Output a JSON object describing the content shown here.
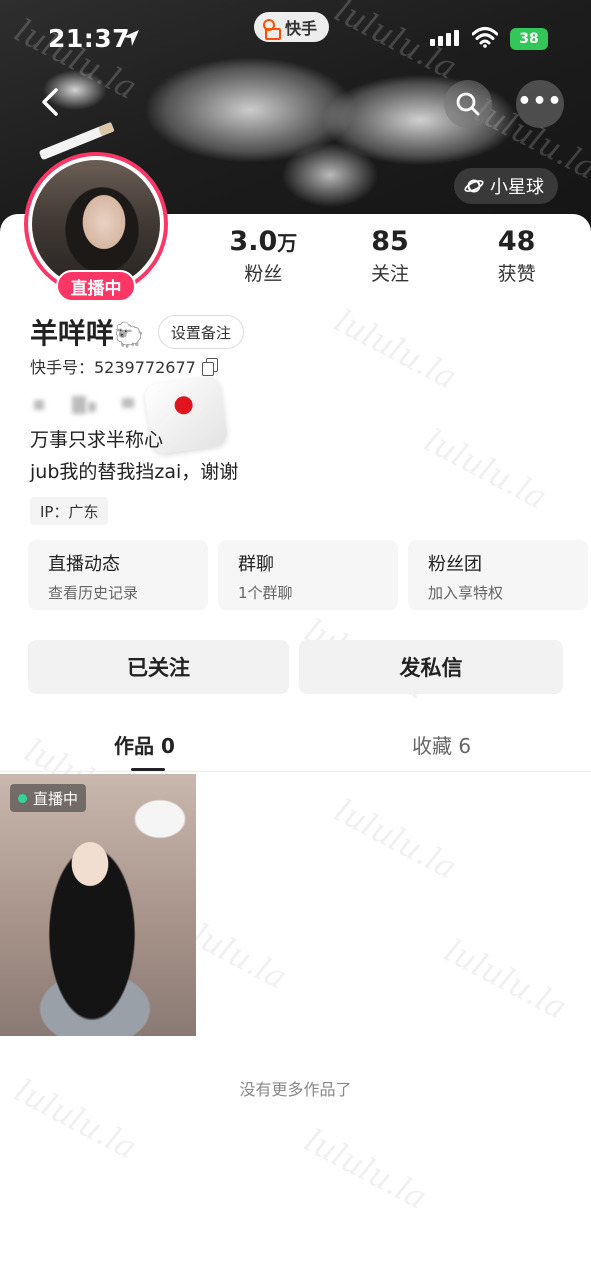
{
  "status_bar": {
    "time": "21:37",
    "battery": "38",
    "icons": [
      "location-arrow-icon",
      "signal-icon",
      "wifi-icon",
      "battery-icon"
    ]
  },
  "app_pill": {
    "label": "快手",
    "icon": "kuaishou-logo-icon"
  },
  "header": {
    "back_icon": "chevron-left-icon",
    "search_icon": "search-icon",
    "more_icon": "more-icon",
    "more_glyph": "•••",
    "planet_label": "小星球"
  },
  "profile": {
    "live_tag": "直播中",
    "name": "羊咩咩",
    "name_emoji": "🐑",
    "remark_button": "设置备注",
    "kuaishou_id": "快手号：5239772677",
    "bio_line1": "万事只求半称心",
    "bio_line2": "jub我的替我挡zai，谢谢",
    "ip": "IP：广东"
  },
  "stats": [
    {
      "value": "3.0",
      "unit": "万",
      "label": "粉丝"
    },
    {
      "value": "85",
      "unit": "",
      "label": "关注"
    },
    {
      "value": "48",
      "unit": "",
      "label": "获赞"
    }
  ],
  "features": [
    {
      "title": "直播动态",
      "subtitle": "查看历史记录"
    },
    {
      "title": "群聊",
      "subtitle": "1个群聊"
    },
    {
      "title": "粉丝团",
      "subtitle": "加入享特权"
    }
  ],
  "actions": {
    "following": "已关注",
    "message": "发私信"
  },
  "tabs": {
    "works": "作品 0",
    "favorites": "收藏 6"
  },
  "thumbnail": {
    "live_label": "直播中"
  },
  "footer": {
    "no_more": "没有更多作品了"
  },
  "watermark": "lululu.la",
  "colors": {
    "accent": "#fe3666",
    "live_dot": "#34d39a",
    "battery": "#33c759"
  }
}
